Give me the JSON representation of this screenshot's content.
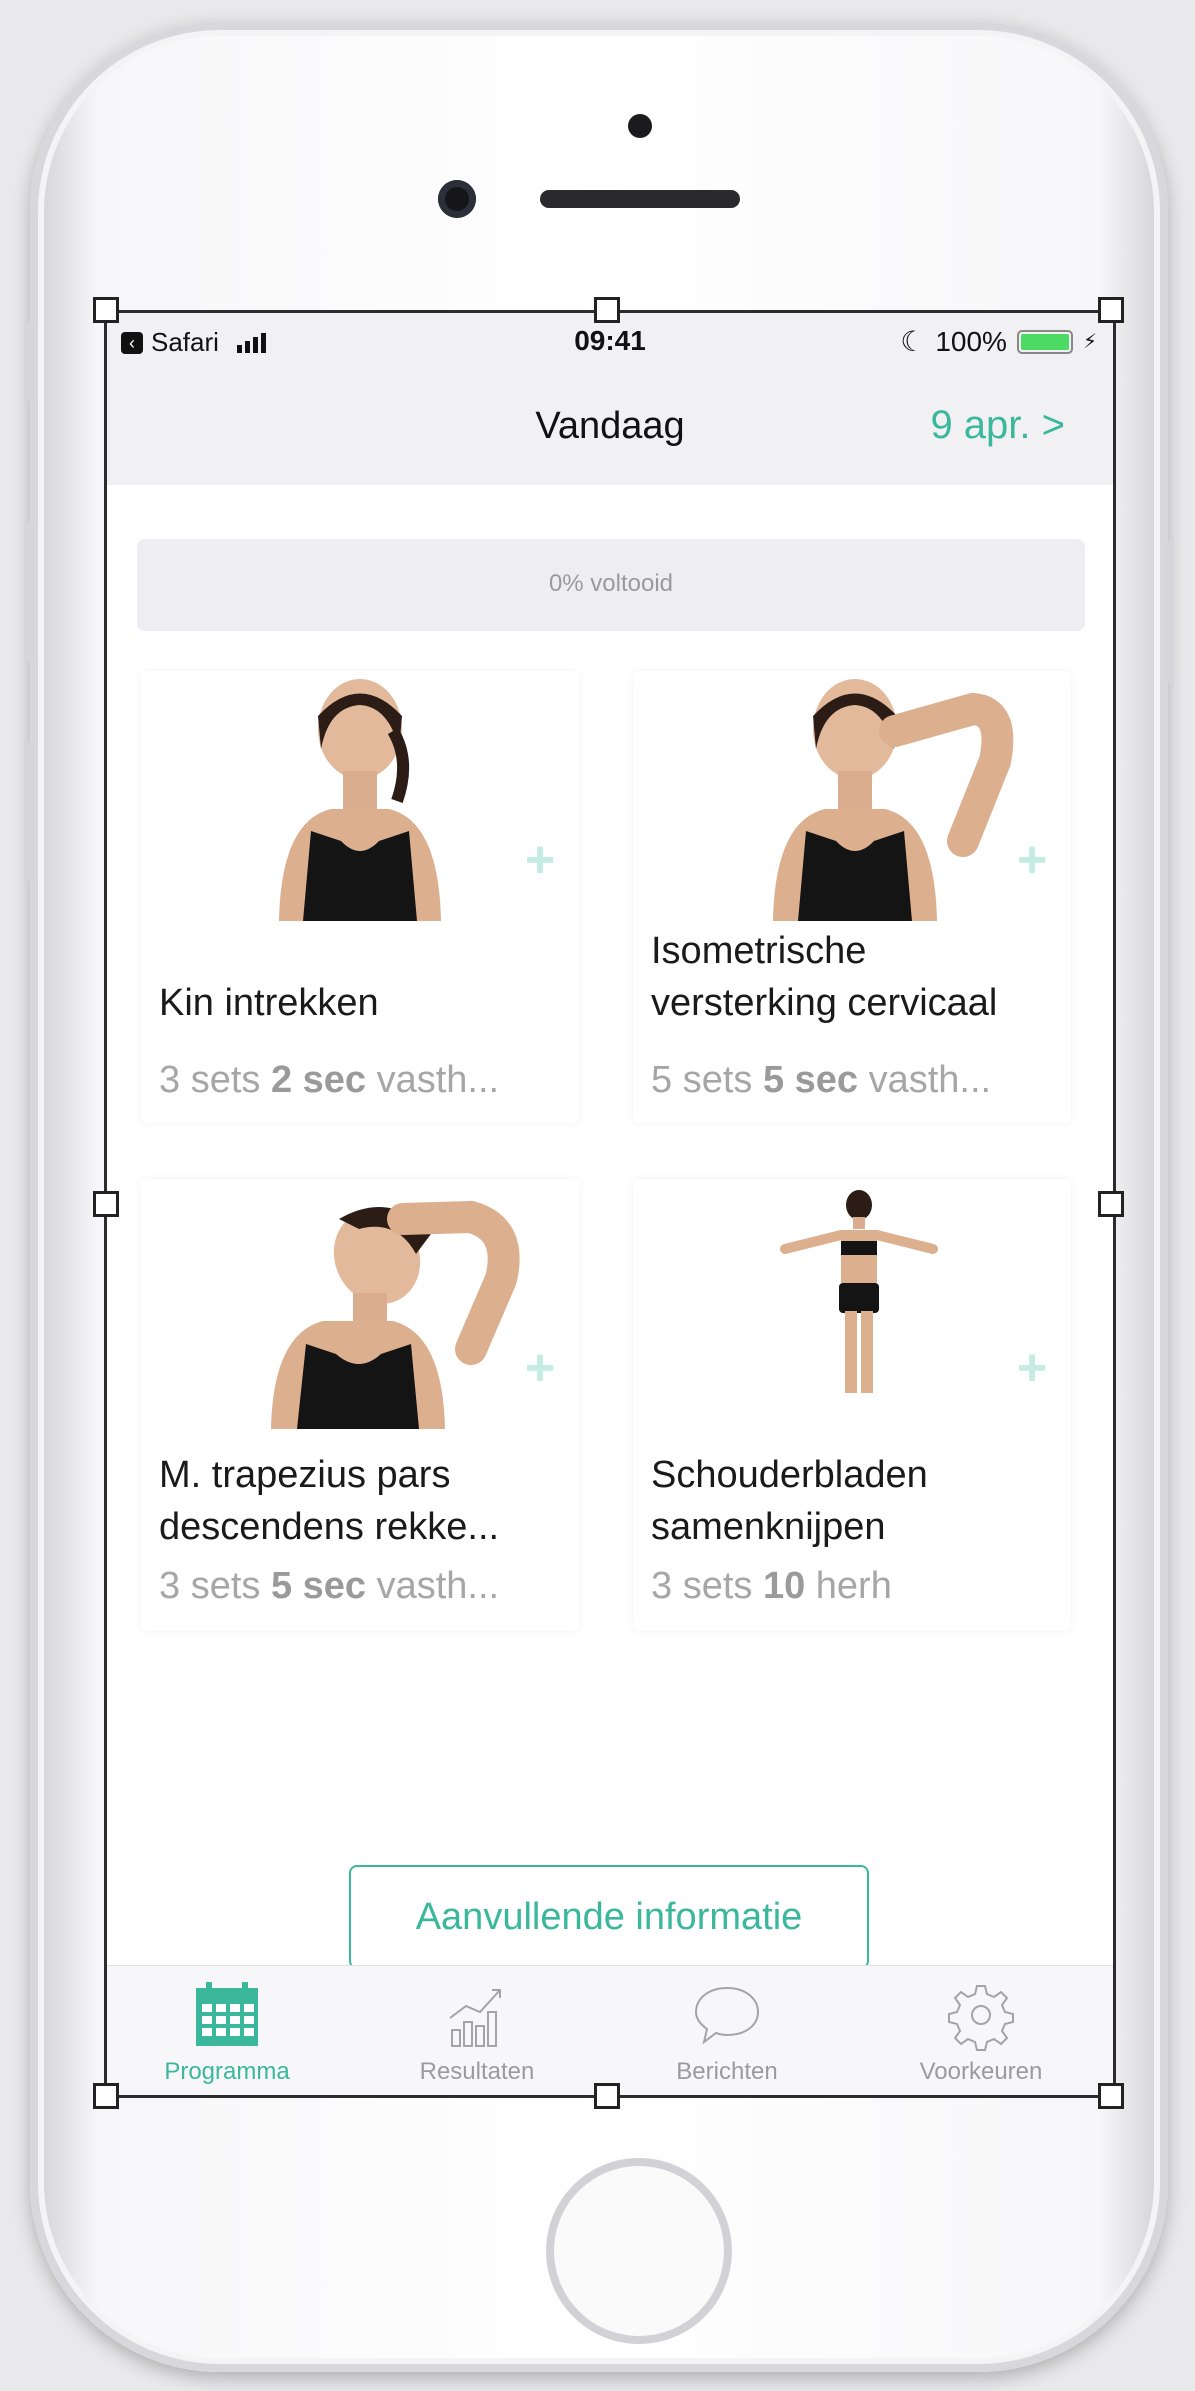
{
  "status_bar": {
    "back_app": "Safari",
    "time": "09:41",
    "battery": "100%"
  },
  "header": {
    "title": "Vandaag",
    "date_link": "9 apr. >"
  },
  "progress": {
    "label": "0% voltooid",
    "value": 0
  },
  "exercises": [
    {
      "name": "Kin intrekken",
      "meta_sets": "3 sets ",
      "meta_bold": "2 sec",
      "meta_rest": " vasth..."
    },
    {
      "name": "Isometrische versterking cervicaal",
      "meta_sets": "5 sets ",
      "meta_bold": "5 sec",
      "meta_rest": " vasth..."
    },
    {
      "name": "M. trapezius pars descendens rekke...",
      "meta_sets": "3 sets ",
      "meta_bold": "5 sec",
      "meta_rest": " vasth..."
    },
    {
      "name": "Schouderbladen samenknijpen",
      "meta_sets": "3 sets ",
      "meta_bold": "10",
      "meta_rest": " herh"
    }
  ],
  "info_button": "Aanvullende informatie",
  "tabs": [
    {
      "label": "Programma",
      "icon": "calendar-icon"
    },
    {
      "label": "Resultaten",
      "icon": "chart-icon"
    },
    {
      "label": "Berichten",
      "icon": "chat-bubble-icon"
    },
    {
      "label": "Voorkeuren",
      "icon": "gear-icon"
    }
  ],
  "colors": {
    "accent": "#3bb89c",
    "battery": "#4cd964"
  }
}
